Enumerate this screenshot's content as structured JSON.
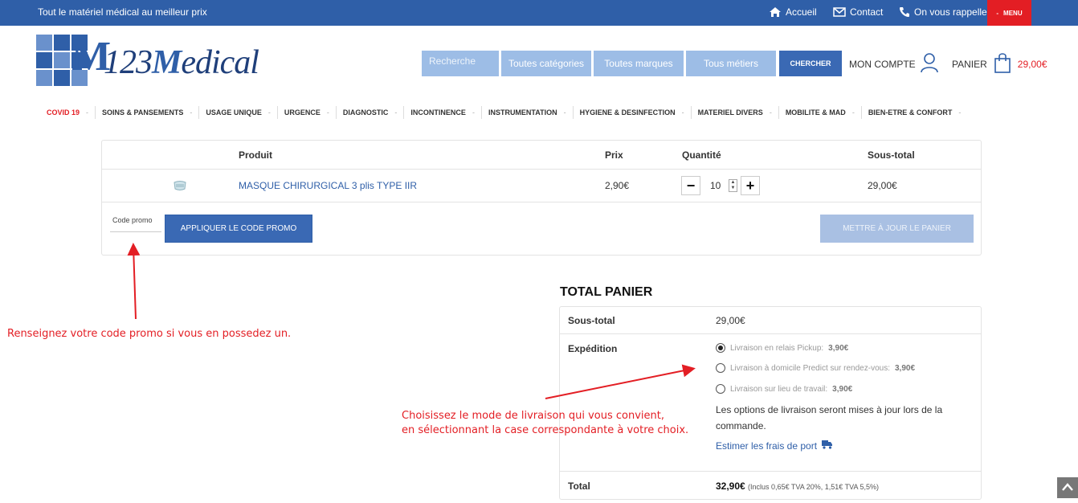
{
  "topbar": {
    "tagline": "Tout le matériel médical au meilleur prix",
    "links": {
      "home": "Accueil",
      "contact": "Contact",
      "callback": "On vous rappelle"
    },
    "menu_label": "MENU"
  },
  "logo": {
    "big_letter": "M",
    "brand_prefix": "123",
    "brand_rest": "edical",
    "brand_M": "M"
  },
  "search": {
    "placeholder": "Recherche",
    "categories": "Toutes catégories",
    "brands": "Toutes marques",
    "jobs": "Tous métiers",
    "button": "CHERCHER"
  },
  "account": {
    "label": "MON COMPTE"
  },
  "cart_header": {
    "label": "PANIER",
    "amount": "29,00€"
  },
  "nav": {
    "items": [
      {
        "label": "COVID 19",
        "highlight": true
      },
      {
        "label": "SOINS & PANSEMENTS"
      },
      {
        "label": "USAGE UNIQUE"
      },
      {
        "label": "URGENCE"
      },
      {
        "label": "DIAGNOSTIC"
      },
      {
        "label": "INCONTINENCE"
      },
      {
        "label": "INSTRUMENTATION"
      },
      {
        "label": "HYGIENE & DESINFECTION"
      },
      {
        "label": "MATERIEL DIVERS"
      },
      {
        "label": "MOBILITE & MAD"
      },
      {
        "label": "BIEN-ETRE & CONFORT"
      }
    ],
    "separator": "-"
  },
  "cart_table": {
    "headers": {
      "product": "Produit",
      "price": "Prix",
      "quantity": "Quantité",
      "subtotal": "Sous-total"
    },
    "row": {
      "product": "MASQUE CHIRURGICAL 3 plis TYPE IIR",
      "price": "2,90€",
      "quantity": "10",
      "subtotal": "29,00€"
    },
    "minus": "−",
    "plus": "+",
    "promo_placeholder": "Code promo",
    "apply_promo": "APPLIQUER LE CODE PROMO",
    "update_cart": "METTRE À JOUR LE PANIER"
  },
  "totals": {
    "title": "TOTAL PANIER",
    "subtotal_label": "Sous-total",
    "subtotal_value": "29,00€",
    "shipping_label": "Expédition",
    "shipping_options": [
      {
        "label": "Livraison en relais Pickup:",
        "price": "3,90€",
        "selected": true
      },
      {
        "label": "Livraison à domicile Predict sur rendez-vous:",
        "price": "3,90€",
        "selected": false
      },
      {
        "label": "Livraison sur lieu de travail:",
        "price": "3,90€",
        "selected": false
      }
    ],
    "shipping_note": "Les options de livraison seront mises à jour lors de la commande.",
    "estimate_link": "Estimer les frais de port",
    "total_label": "Total",
    "total_value": "32,90€",
    "total_tax_note": "(Inclus 0,65€ TVA 20%, 1,51€ TVA 5,5%)"
  },
  "annotations": {
    "promo_hint": "Renseignez votre code promo si vous en possedez un.",
    "shipping_hint_1": "Choisissez le mode de livraison qui vous convient,",
    "shipping_hint_2": "en sélectionnant la case correspondante à votre choix."
  },
  "colors": {
    "brand": "#2f5fa8",
    "accent_red": "#e31e24",
    "light_blue": "#9dbde6"
  }
}
